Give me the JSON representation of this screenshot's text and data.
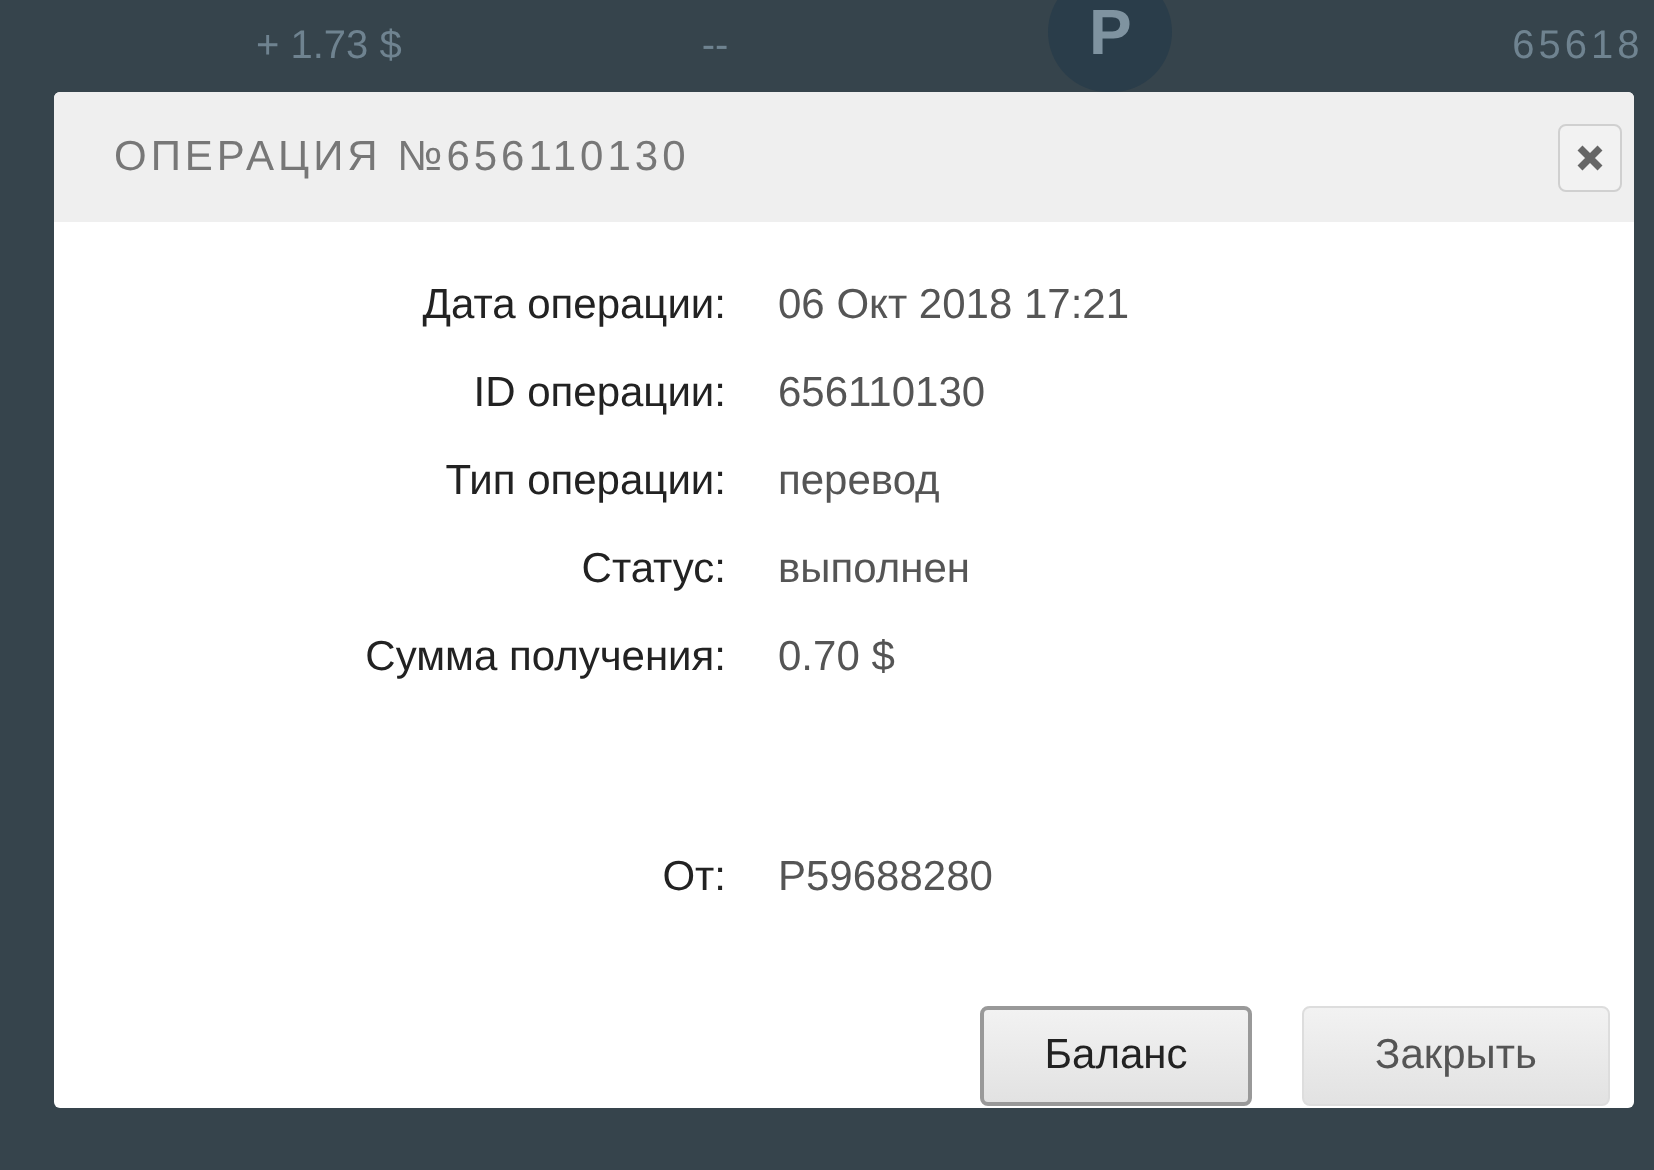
{
  "background_row": {
    "amount": "+ 1.73 $",
    "dash": "--",
    "logo_letter": "P",
    "number": "65618"
  },
  "dialog": {
    "title": "ОПЕРАЦИЯ №656110130",
    "fields": [
      {
        "label": "Дата операции:",
        "value": "06 Окт 2018 17:21"
      },
      {
        "label": "ID операции:",
        "value": "656110130"
      },
      {
        "label": "Тип операции:",
        "value": "перевод"
      },
      {
        "label": "Статус:",
        "value": "выполнен"
      },
      {
        "label": "Сумма получения:",
        "value": "0.70 $"
      }
    ],
    "sender": {
      "label": "От:",
      "value": "P59688280"
    },
    "buttons": [
      {
        "label": "Баланс",
        "selected": true
      },
      {
        "label": "Закрыть",
        "selected": false
      }
    ]
  }
}
